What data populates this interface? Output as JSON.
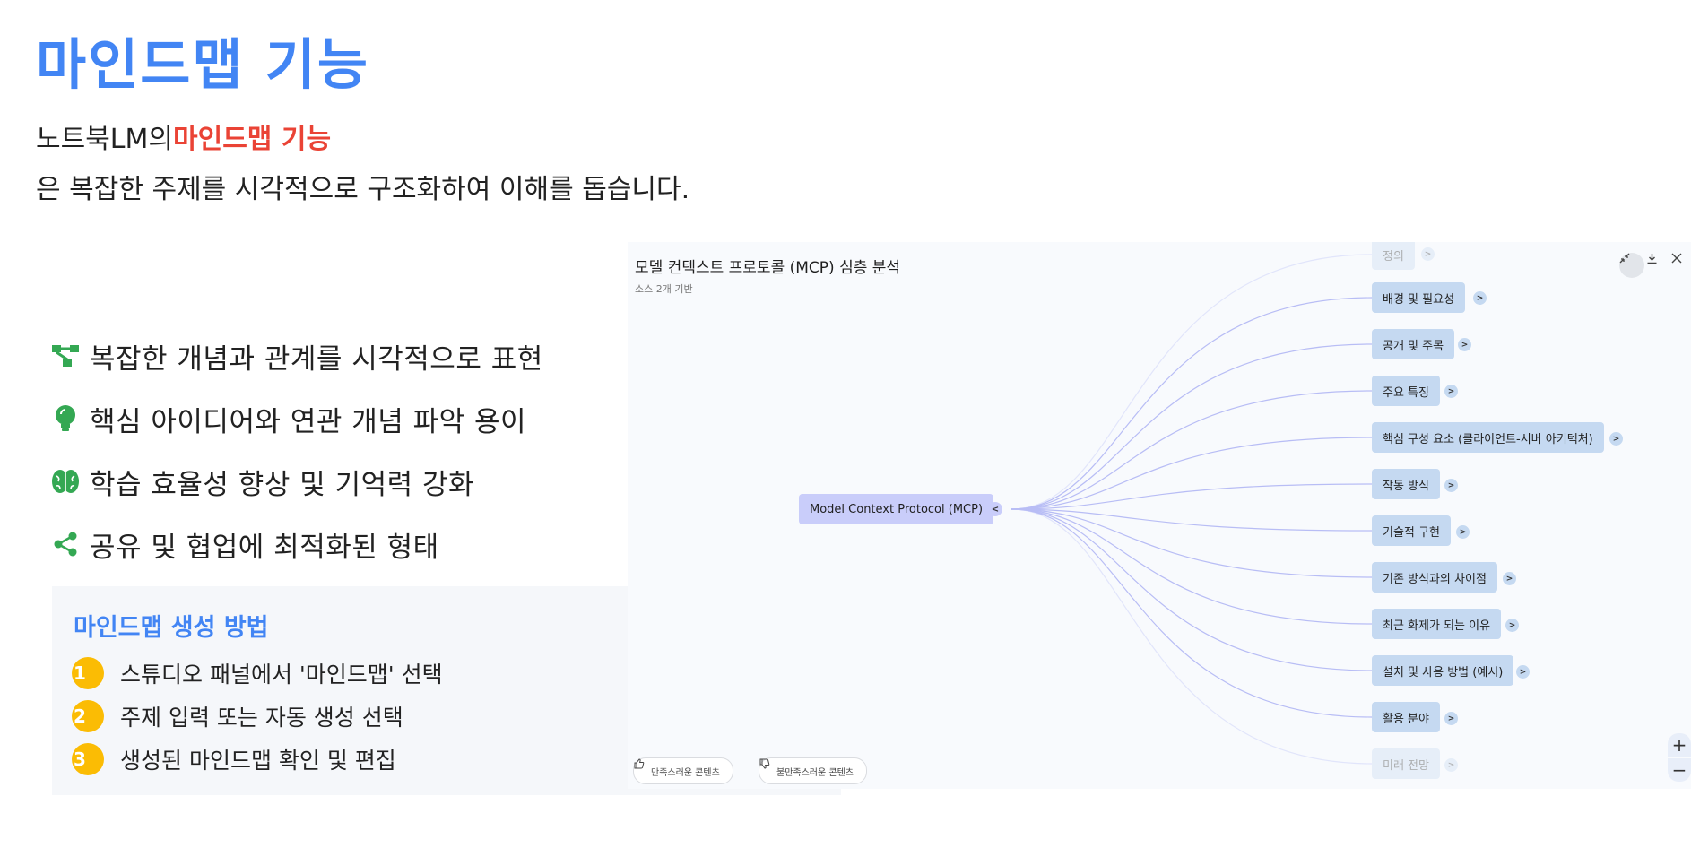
{
  "heading": {
    "title": "마인드맵 기능",
    "intro_prefix": "노트북LM의",
    "intro_highlight": "마인드맵 기능",
    "intro_rest": "은 복잡한 주제를 시각적으로 구조화하여 이해를 돕습니다."
  },
  "features": [
    {
      "icon": "tree-structure-icon",
      "text": "복잡한 개념과 관계를 시각적으로 표현"
    },
    {
      "icon": "lightbulb-icon",
      "text": "핵심 아이디어와 연관 개념 파악 용이"
    },
    {
      "icon": "brain-icon",
      "text": "학습 효율성 향상 및 기억력 강화"
    },
    {
      "icon": "share-icon",
      "text": "공유 및 협업에 최적화된 형태"
    }
  ],
  "how_to": {
    "title": "마인드맵 생성 방법",
    "steps": [
      {
        "num": "1",
        "text": "스튜디오 패널에서 '마인드맵' 선택"
      },
      {
        "num": "2",
        "text": "주제 입력 또는 자동 생성 선택"
      },
      {
        "num": "3",
        "text": "생성된 마인드맵 확인 및 편집"
      }
    ]
  },
  "mindmap": {
    "title": "모델 컨텍스트 프로토콜 (MCP) 심층 분석",
    "subtitle": "소스 2개 기반",
    "root": "Model Context Protocol (MCP)",
    "root_toggle": "<",
    "children": [
      {
        "label": "정의",
        "toggle": ">"
      },
      {
        "label": "배경 및 필요성",
        "toggle": ">"
      },
      {
        "label": "공개 및 주목",
        "toggle": ">"
      },
      {
        "label": "주요 특징",
        "toggle": ">"
      },
      {
        "label": "핵심 구성 요소 (클라이언트-서버 아키텍처)",
        "toggle": ">"
      },
      {
        "label": "작동 방식",
        "toggle": ">"
      },
      {
        "label": "기술적 구현",
        "toggle": ">"
      },
      {
        "label": "기존 방식과의 차이점",
        "toggle": ">"
      },
      {
        "label": "최근 화제가 되는 이유",
        "toggle": ">"
      },
      {
        "label": "설치 및 사용 방법 (예시)",
        "toggle": ">"
      },
      {
        "label": "활용 분야",
        "toggle": ">"
      },
      {
        "label": "미래 전망",
        "toggle": ">"
      }
    ],
    "zoom_in": "+",
    "zoom_out": "−",
    "feedback_like": "만족스러운 콘텐츠",
    "feedback_dislike": "불만족스러운 콘텐츠",
    "colors": {
      "root": "#c9cdfa",
      "child": "#c5d9f1",
      "edge": "#b8bdf5"
    }
  },
  "colors": {
    "title": "#4285f4",
    "highlight": "#ea4335",
    "icon_green": "#34a853",
    "step_badge": "#fbbc04"
  }
}
